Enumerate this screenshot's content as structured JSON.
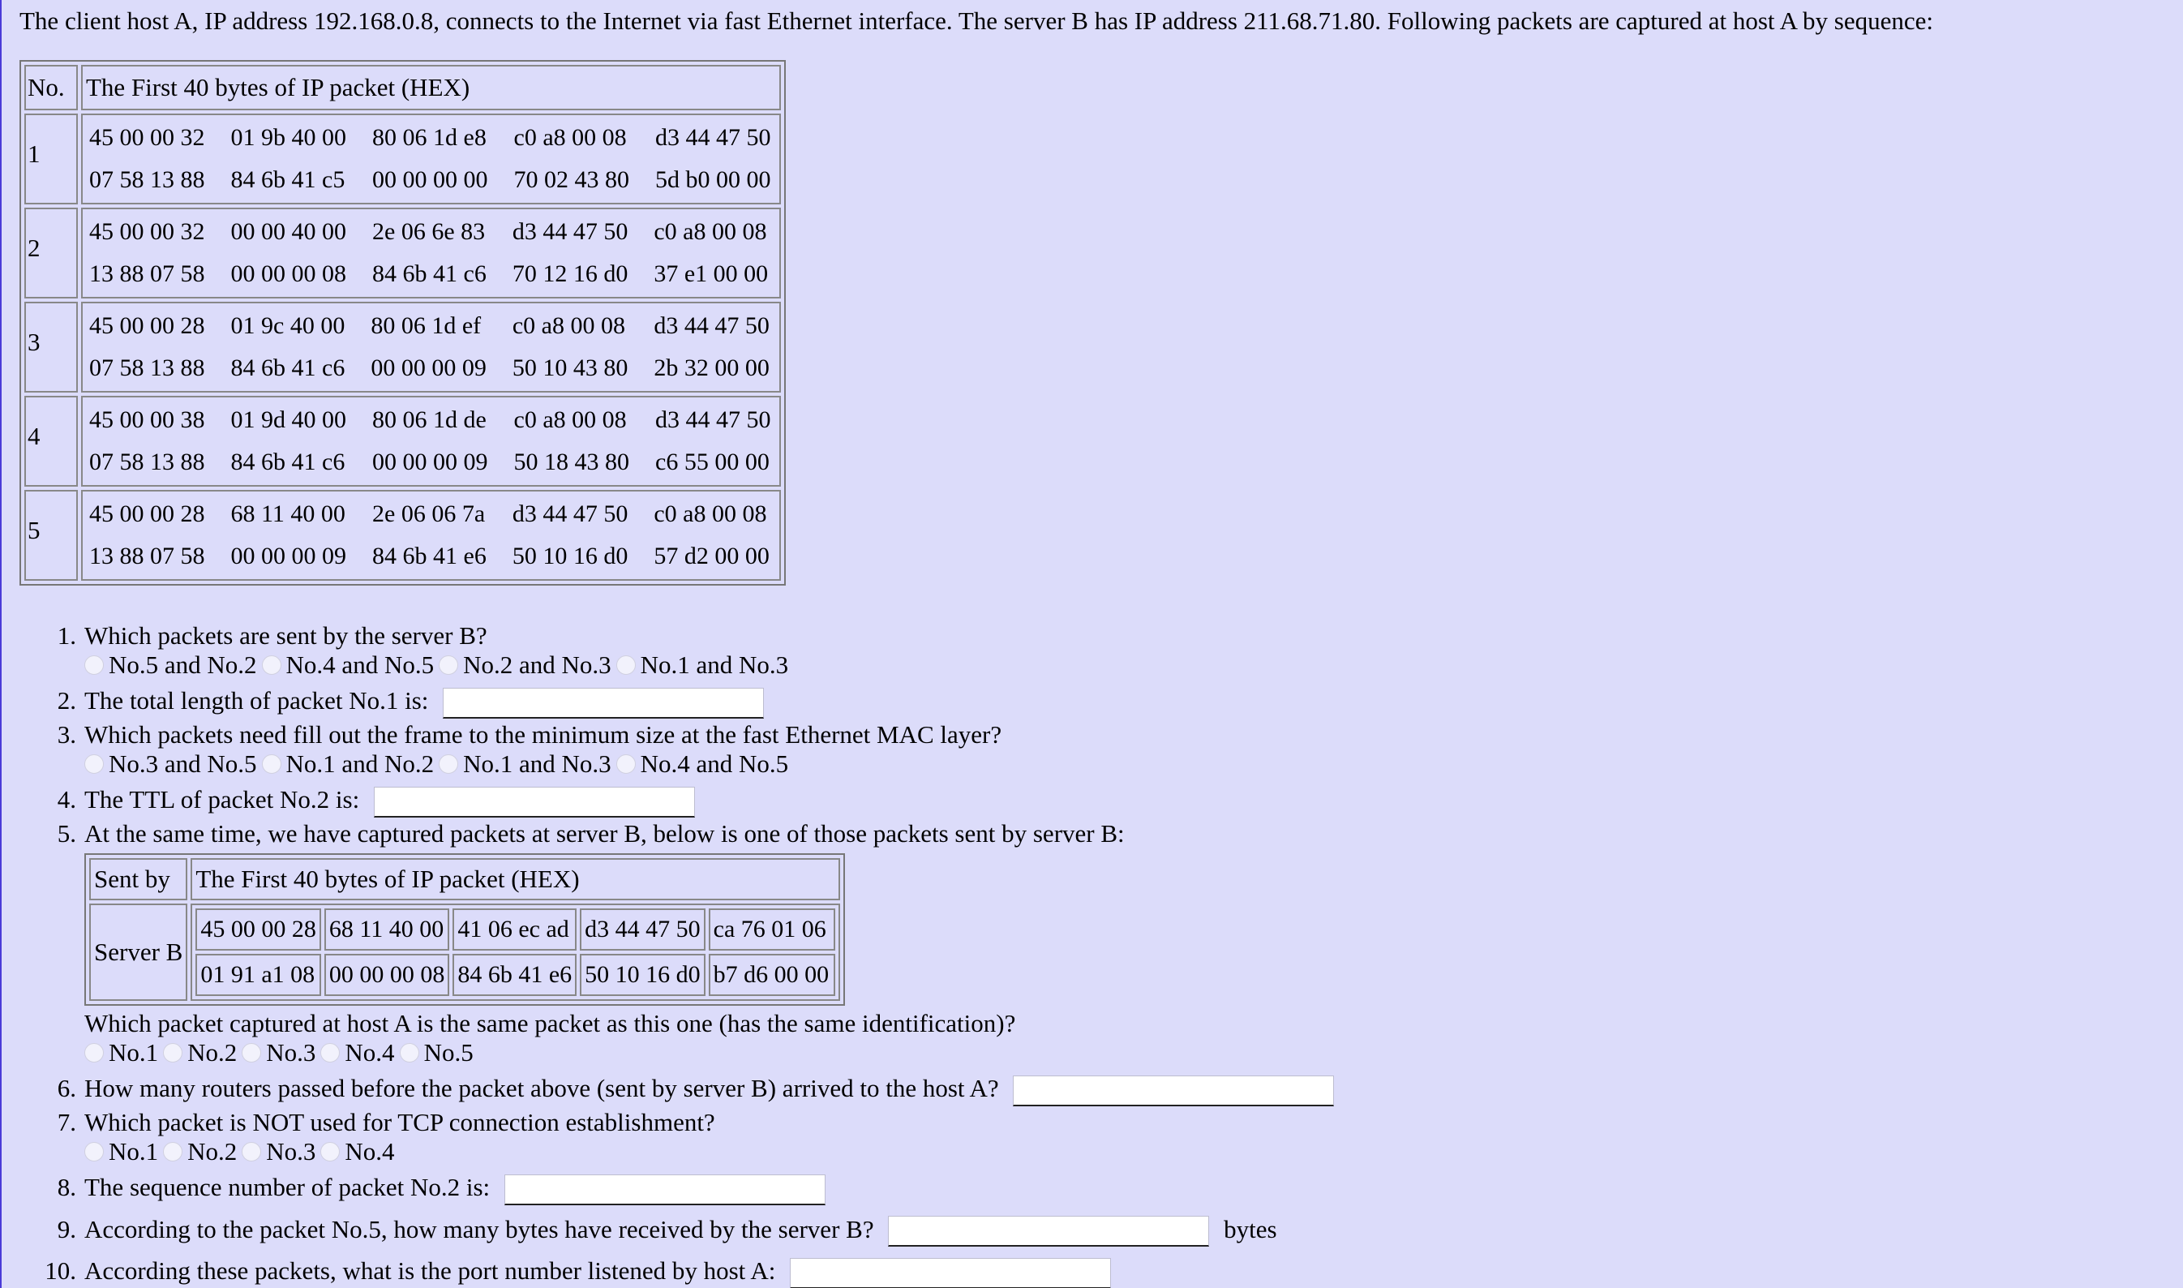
{
  "intro": "The client host A, IP address 192.168.0.8, connects to the Internet via fast Ethernet interface. The server B has IP address 211.68.71.80. Following packets are captured at host A by sequence:",
  "packet_table": {
    "header_no": "No.",
    "header_bytes": "The First 40 bytes of IP packet (HEX)",
    "rows": [
      {
        "no": "1",
        "line1": [
          "45 00 00 32",
          "01 9b 40 00",
          "80 06 1d e8",
          "c0 a8 00 08",
          "d3 44 47 50"
        ],
        "line2": [
          "07 58 13 88",
          "84 6b 41 c5",
          "00 00 00 00",
          "70 02 43 80",
          "5d b0 00 00"
        ]
      },
      {
        "no": "2",
        "line1": [
          "45 00 00 32",
          "00 00 40 00",
          "2e 06 6e 83",
          "d3 44 47 50",
          "c0 a8 00 08"
        ],
        "line2": [
          "13 88 07 58",
          "00 00 00 08",
          "84 6b 41 c6",
          "70 12 16 d0",
          "37 e1 00 00"
        ]
      },
      {
        "no": "3",
        "line1": [
          "45 00 00 28",
          "01 9c 40 00",
          "80 06 1d ef",
          "c0 a8 00 08",
          "d3 44 47 50"
        ],
        "line2": [
          "07 58 13 88",
          "84 6b 41 c6",
          "00 00 00 09",
          "50 10 43 80",
          "2b 32 00 00"
        ]
      },
      {
        "no": "4",
        "line1": [
          "45 00 00 38",
          "01 9d 40 00",
          "80 06 1d de",
          "c0 a8 00 08",
          "d3 44 47 50"
        ],
        "line2": [
          "07 58 13 88",
          "84 6b 41 c6",
          "00 00 00 09",
          "50 18 43 80",
          "c6 55 00 00"
        ]
      },
      {
        "no": "5",
        "line1": [
          "45 00 00 28",
          "68 11 40 00",
          "2e 06 06 7a",
          "d3 44 47 50",
          "c0 a8 00 08"
        ],
        "line2": [
          "13 88 07 58",
          "00 00 00 09",
          "84 6b 41 e6",
          "50 10 16 d0",
          "57 d2 00 00"
        ]
      }
    ]
  },
  "questions": {
    "q1": {
      "num": "1.",
      "text": "Which packets are sent by the server B?",
      "options": [
        "No.5 and No.2",
        "No.4 and No.5",
        "No.2 and No.3",
        "No.1 and No.3"
      ]
    },
    "q2": {
      "num": "2.",
      "text": "The total length of packet No.1 is:",
      "value": ""
    },
    "q3": {
      "num": "3.",
      "text": "Which packets need fill out the frame to the minimum size at the fast Ethernet MAC layer?",
      "options": [
        "No.3 and No.5",
        "No.1 and No.2",
        "No.1 and No.3",
        "No.4 and No.5"
      ]
    },
    "q4": {
      "num": "4.",
      "text": "The TTL of packet No.2 is:",
      "value": ""
    },
    "q5": {
      "num": "5.",
      "text": "At the same time, we have captured packets at server B, below is one of those packets sent by server B:",
      "table": {
        "header_sent_by": "Sent by",
        "header_bytes": "The First 40 bytes of IP packet (HEX)",
        "sender": "Server B",
        "line1": [
          "45 00 00 28",
          "68 11 40 00",
          "41 06 ec ad",
          "d3 44 47 50",
          "ca 76 01 06"
        ],
        "line2": [
          "01 91 a1 08",
          "00 00 00 08",
          "84 6b 41 e6",
          "50 10 16 d0",
          "b7 d6 00 00"
        ]
      },
      "subtext": "Which packet captured at host A is the same packet as this one (has the same identification)?",
      "options": [
        "No.1",
        "No.2",
        "No.3",
        "No.4",
        "No.5"
      ]
    },
    "q6": {
      "num": "6.",
      "text": "How many routers passed before the packet above (sent by server B) arrived to the host A?",
      "value": ""
    },
    "q7": {
      "num": "7.",
      "text": "Which packet is NOT used for TCP connection establishment?",
      "options": [
        "No.1",
        "No.2",
        "No.3",
        "No.4"
      ]
    },
    "q8": {
      "num": "8.",
      "text": "The sequence number of packet No.2 is:",
      "value": ""
    },
    "q9": {
      "num": "9.",
      "text": "According to the packet No.5, how many bytes have received by the server B?",
      "value": "",
      "suffix": "bytes"
    },
    "q10": {
      "num": "10.",
      "text": "According these packets, what is the port number listened by host A:",
      "value": ""
    }
  }
}
